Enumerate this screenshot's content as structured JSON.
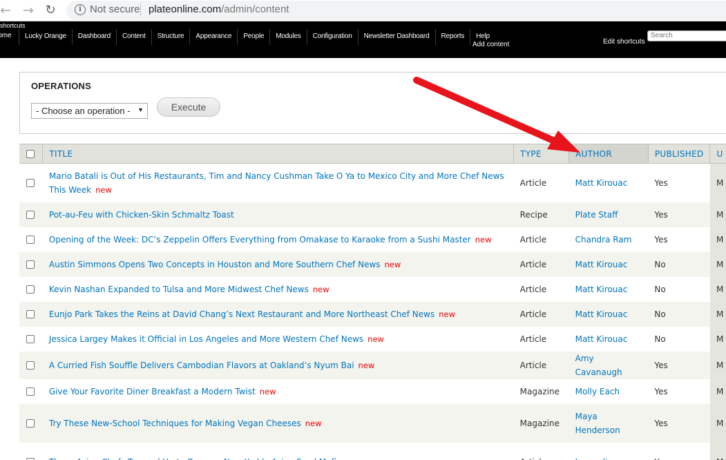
{
  "browser": {
    "security": "Not secure",
    "url_host": "plateonline.com",
    "url_path": "/admin/content"
  },
  "toolbar": {
    "shortcuts_label": "Show shortcuts",
    "home": "Home",
    "menu": [
      "Lucky Orange",
      "Dashboard",
      "Content",
      "Structure",
      "Appearance",
      "People",
      "Modules",
      "Configuration",
      "Newsletter Dashboard",
      "Reports",
      "Help"
    ],
    "add_content": "Add content",
    "edit_shortcuts": "Edit shortcuts",
    "search_placeholder": "Search"
  },
  "operations": {
    "title": "OPERATIONS",
    "select_value": "- Choose an operation -",
    "execute_label": "Execute"
  },
  "table": {
    "headers": {
      "title": "TITLE",
      "type": "TYPE",
      "author": "AUTHOR",
      "published": "PUBLISHED",
      "updated": "U"
    },
    "new_label": "new",
    "rows": [
      {
        "title": "Mario Batali is Out of His Restaurants, Tim and Nancy Cushman Take O Ya to Mexico City and More Chef News This Week",
        "new": true,
        "type": "Article",
        "author": "Matt Kirouac",
        "published": "Yes",
        "updated": "M"
      },
      {
        "title": "Pot-au-Feu with Chicken-Skin Schmaltz Toast",
        "new": false,
        "type": "Recipe",
        "author": "Plate Staff",
        "published": "Yes",
        "updated": "M"
      },
      {
        "title": "Opening of the Week: DC’s Zeppelin Offers Everything from Omakase to Karaoke from a Sushi Master",
        "new": true,
        "type": "Article",
        "author": "Chandra Ram",
        "published": "Yes",
        "updated": "M"
      },
      {
        "title": "Austin Simmons Opens Two Concepts in Houston and More Southern Chef News",
        "new": true,
        "type": "Article",
        "author": "Matt Kirouac",
        "published": "No",
        "updated": "M"
      },
      {
        "title": "Kevin Nashan Expanded to Tulsa and More Midwest Chef News",
        "new": true,
        "type": "Article",
        "author": "Matt Kirouac",
        "published": "No",
        "updated": "M"
      },
      {
        "title": "Eunjo Park Takes the Reins at David Chang’s Next Restaurant and More Northeast Chef News",
        "new": true,
        "type": "Article",
        "author": "Matt Kirouac",
        "published": "No",
        "updated": "M"
      },
      {
        "title": "Jessica Largey Makes it Official in Los Angeles and More Western Chef News",
        "new": true,
        "type": "Article",
        "author": "Matt Kirouac",
        "published": "No",
        "updated": "M"
      },
      {
        "title": "A Curried Fish Souffle Delivers Cambodian Flavors at Oakland’s Nyum Bai",
        "new": true,
        "type": "Article",
        "author": "Amy Cavanaugh",
        "published": "Yes",
        "updated": "M"
      },
      {
        "title": "Give Your Favorite Diner Breakfast a Modern Twist",
        "new": true,
        "type": "Magazine",
        "author": "Molly Each",
        "published": "Yes",
        "updated": "M"
      },
      {
        "title": "Try These New-School Techniques for Making Vegan Cheeses",
        "new": true,
        "type": "Magazine",
        "author": "Maya Henderson",
        "published": "Yes",
        "updated": "M"
      },
      {
        "title": "These Asian Chefs Teamed Up to Become New York’s Asian Food Mafia",
        "new": true,
        "type": "Article",
        "author": "Jacqueline",
        "published": "Yes",
        "updated": "M"
      }
    ]
  },
  "colors": {
    "link": "#0074bd",
    "new_marker": "#e00000",
    "annotation_arrow": "#e8141b"
  }
}
